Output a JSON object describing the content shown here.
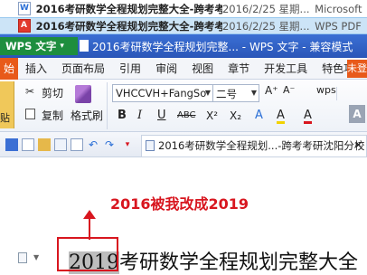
{
  "explorer": {
    "files": [
      {
        "name": "2016考研数学全程规划完整大全-跨考考...",
        "date": "2016/2/25 星期...",
        "type": "Microsoft",
        "icon": "word-doc-icon"
      },
      {
        "name": "2016考研数学全程规划完整大全-跨考考...",
        "date": "2016/2/25 星期...",
        "type": "WPS PDF",
        "icon": "pdf-icon"
      }
    ]
  },
  "titlebar": {
    "app_menu": "WPS 文字",
    "document_title": "2016考研数学全程规划完整... - WPS 文字 - 兼容模式"
  },
  "menu": {
    "items": [
      "始",
      "插入",
      "页面布局",
      "引用",
      "审阅",
      "视图",
      "章节",
      "开发工具",
      "特色功能"
    ],
    "login": "未登"
  },
  "ribbon": {
    "paste_label": "贴",
    "cut_label": "剪切",
    "copy_label": "复制",
    "format_painter_label": "格式刷",
    "font_name": "VHCCVH+FangSo",
    "font_size": "二号",
    "grow_font": "A⁺",
    "shrink_font": "A⁻",
    "wps_label": "wps",
    "format_buttons": [
      "B",
      "I",
      "U",
      "ABC",
      "X²",
      "X₂",
      "A",
      "A",
      "A"
    ]
  },
  "quickbar": {
    "doc_tab_label": "2016考研数学全程规划...-跨考考研沈阳分校 *",
    "close_glyph": "✕"
  },
  "document": {
    "annotation": "2016被我改成2019",
    "heading_highlight": "2019",
    "heading_rest": "考研数学全程规划完整大全"
  }
}
